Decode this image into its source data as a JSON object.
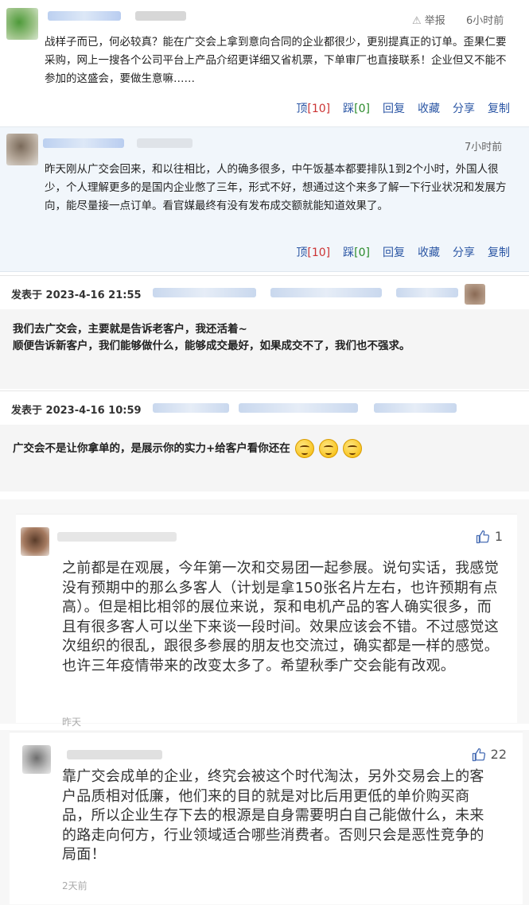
{
  "comment1": {
    "report_label": "举报",
    "time": "6小时前",
    "text": "战样子而已，何必较真？能在广交会上拿到意向合同的企业都很少，更别提真正的订单。歪果仁要采购，网上一搜各个公司平台上产品介绍更详细又省机票，下单审厂也直接联系！企业但又不能不参加的这盛会，要做生意嘛……",
    "actions": {
      "up": "顶",
      "up_count": "[10]",
      "down": "踩",
      "down_count": "[0]",
      "reply": "回复",
      "fav": "收藏",
      "share": "分享",
      "copy": "复制"
    }
  },
  "comment2": {
    "time": "7小时前",
    "text": "昨天刚从广交会回来，和以往相比，人的确多很多，中午饭基本都要排队1到2个小时，外国人很少，个人理解更多的是国内企业憋了三年，形式不好，想通过这个来多了解一下行业状况和发展方向，能尽量接一点订单。看官媒最终有没有发布成交额就能知道效果了。",
    "actions": {
      "up": "顶",
      "up_count": "[10]",
      "down": "踩",
      "down_count": "[0]",
      "reply": "回复",
      "fav": "收藏",
      "share": "分享",
      "copy": "复制"
    }
  },
  "post1": {
    "posted": "发表于 2023-4-16 21:55",
    "line1": "我们去广交会，主要就是告诉老客户，我还活着~",
    "line2": "顺便告诉新客户，我们能够做什么，能够成交最好，如果成交不了，我们也不强求。"
  },
  "post2": {
    "posted": "发表于 2023-4-16 10:59",
    "text": "广交会不是让你拿单的，是展示你的实力+给客户看你还在"
  },
  "app_comment1": {
    "likes": "1",
    "text": "之前都是在观展，今年第一次和交易团一起参展。说句实话，我感觉没有预期中的那么多客人（计划是拿150张名片左右，也许预期有点高）。但是相比相邻的展位来说，泵和电机产品的客人确实很多，而且有很多客人可以坐下来谈一段时间。效果应该会不错。不过感觉这次组织的很乱，跟很多参展的朋友也交流过，确实都是一样的感觉。也许三年疫情带来的改变太多了。希望秋季广交会能有改观。",
    "time": "昨天"
  },
  "app_comment2": {
    "likes": "22",
    "text": "靠广交会成单的企业，终究会被这个时代淘汰，另外交易会上的客户品质相对低廉，他们来的目的就是对比后用更低的单价购买商品，所以企业生存下去的根源是自身需要明白自己能做什么，未来的路走向何方，行业领域适合哪些消费者。否则只会是恶性竞争的局面！",
    "time": "2天前"
  }
}
